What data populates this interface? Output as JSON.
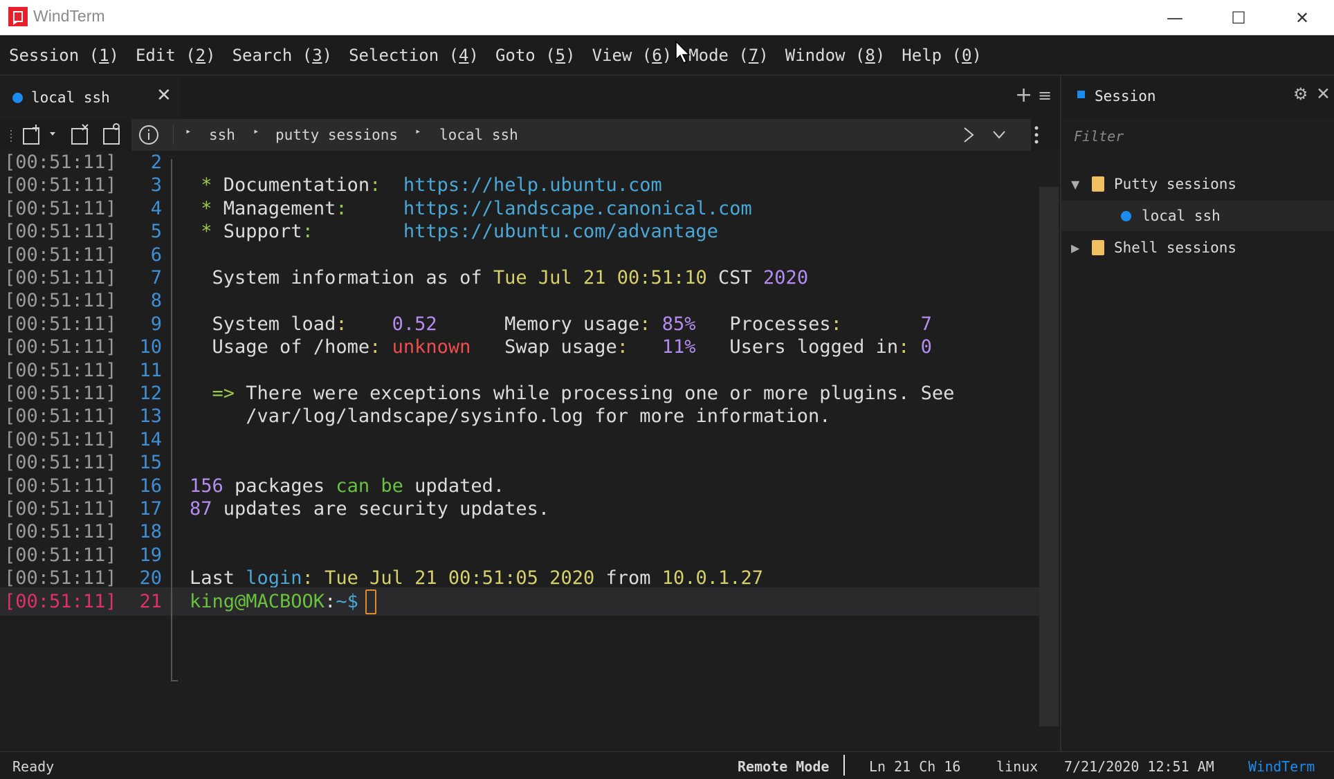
{
  "window": {
    "title": "WindTerm",
    "minimize_glyph": "—",
    "maximize_glyph": "☐",
    "close_glyph": "✕"
  },
  "menu": [
    {
      "label": "Session",
      "key": "1"
    },
    {
      "label": "Edit",
      "key": "2"
    },
    {
      "label": "Search",
      "key": "3"
    },
    {
      "label": "Selection",
      "key": "4"
    },
    {
      "label": "Goto",
      "key": "5"
    },
    {
      "label": "View",
      "key": "6"
    },
    {
      "label": "Mode",
      "key": "7"
    },
    {
      "label": "Window",
      "key": "8"
    },
    {
      "label": "Help",
      "key": "0"
    }
  ],
  "tab": {
    "label": "local ssh",
    "close": "✕",
    "add": "+",
    "menu": "≡"
  },
  "breadcrumb": [
    "ssh",
    "putty sessions",
    "local ssh"
  ],
  "terminal": {
    "lines": [
      {
        "ts": "[00:51:11]",
        "ln": "2",
        "segments": []
      },
      {
        "ts": "[00:51:11]",
        "ln": "3",
        "segments": [
          {
            "t": " * ",
            "c": "g"
          },
          {
            "t": "Documentation",
            "c": "w"
          },
          {
            "t": ":  ",
            "c": "g"
          },
          {
            "t": "https://help.ubuntu.com",
            "c": "b"
          }
        ]
      },
      {
        "ts": "[00:51:11]",
        "ln": "4",
        "segments": [
          {
            "t": " * ",
            "c": "g"
          },
          {
            "t": "Management",
            "c": "w"
          },
          {
            "t": ":     ",
            "c": "g"
          },
          {
            "t": "https://landscape.canonical.com",
            "c": "b"
          }
        ]
      },
      {
        "ts": "[00:51:11]",
        "ln": "5",
        "segments": [
          {
            "t": " * ",
            "c": "g"
          },
          {
            "t": "Support",
            "c": "w"
          },
          {
            "t": ":        ",
            "c": "g"
          },
          {
            "t": "https://ubuntu.com/advantage",
            "c": "b"
          }
        ]
      },
      {
        "ts": "[00:51:11]",
        "ln": "6",
        "segments": []
      },
      {
        "ts": "[00:51:11]",
        "ln": "7",
        "segments": [
          {
            "t": "  System information as of ",
            "c": "w"
          },
          {
            "t": "Tue Jul 21 00:51:10",
            "c": "y"
          },
          {
            "t": " CST ",
            "c": "w"
          },
          {
            "t": "2020",
            "c": "p"
          }
        ]
      },
      {
        "ts": "[00:51:11]",
        "ln": "8",
        "segments": []
      },
      {
        "ts": "[00:51:11]",
        "ln": "9",
        "segments": [
          {
            "t": "  System load",
            "c": "w"
          },
          {
            "t": ":    ",
            "c": "y"
          },
          {
            "t": "0.52",
            "c": "p"
          },
          {
            "t": "      Memory usage",
            "c": "w"
          },
          {
            "t": ": ",
            "c": "y"
          },
          {
            "t": "85%",
            "c": "p"
          },
          {
            "t": "   Processes",
            "c": "w"
          },
          {
            "t": ":       ",
            "c": "y"
          },
          {
            "t": "7",
            "c": "p"
          }
        ]
      },
      {
        "ts": "[00:51:11]",
        "ln": "10",
        "segments": [
          {
            "t": "  Usage of /home",
            "c": "w"
          },
          {
            "t": ": ",
            "c": "y"
          },
          {
            "t": "unknown",
            "c": "r"
          },
          {
            "t": "   Swap usage",
            "c": "w"
          },
          {
            "t": ":   ",
            "c": "y"
          },
          {
            "t": "11%",
            "c": "p"
          },
          {
            "t": "   Users logged in",
            "c": "w"
          },
          {
            "t": ": ",
            "c": "y"
          },
          {
            "t": "0",
            "c": "p"
          }
        ]
      },
      {
        "ts": "[00:51:11]",
        "ln": "11",
        "segments": []
      },
      {
        "ts": "[00:51:11]",
        "ln": "12",
        "segments": [
          {
            "t": "  => ",
            "c": "g"
          },
          {
            "t": "There were exceptions while processing one or more plugins. See",
            "c": "w"
          }
        ]
      },
      {
        "ts": "[00:51:11]",
        "ln": "13",
        "segments": [
          {
            "t": "     /var/log/landscape/sysinfo.log for more information.",
            "c": "w"
          }
        ]
      },
      {
        "ts": "[00:51:11]",
        "ln": "14",
        "segments": []
      },
      {
        "ts": "[00:51:11]",
        "ln": "15",
        "segments": []
      },
      {
        "ts": "[00:51:11]",
        "ln": "16",
        "segments": [
          {
            "t": "156",
            "c": "p"
          },
          {
            "t": " packages ",
            "c": "w"
          },
          {
            "t": "can be",
            "c": "gr"
          },
          {
            "t": " updated.",
            "c": "w"
          }
        ]
      },
      {
        "ts": "[00:51:11]",
        "ln": "17",
        "segments": [
          {
            "t": "87",
            "c": "p"
          },
          {
            "t": " updates are security updates.",
            "c": "w"
          }
        ]
      },
      {
        "ts": "[00:51:11]",
        "ln": "18",
        "segments": []
      },
      {
        "ts": "[00:51:11]",
        "ln": "19",
        "segments": []
      },
      {
        "ts": "[00:51:11]",
        "ln": "20",
        "segments": [
          {
            "t": "Last ",
            "c": "w"
          },
          {
            "t": "login",
            "c": "b"
          },
          {
            "t": ": ",
            "c": "y"
          },
          {
            "t": "Tue Jul 21 00:51:05 2020",
            "c": "y"
          },
          {
            "t": " from ",
            "c": "w"
          },
          {
            "t": "10.0.1.27",
            "c": "y"
          }
        ]
      },
      {
        "ts": "[00:51:11]",
        "ln": "21",
        "current": true,
        "segments": [
          {
            "t": "king@MACBOOK",
            "c": "gr"
          },
          {
            "t": ":",
            "c": "w"
          },
          {
            "t": "~$",
            "c": "b"
          }
        ]
      }
    ]
  },
  "session_panel": {
    "title": "Session",
    "filter_placeholder": "Filter",
    "gear": "⚙",
    "close": "✕",
    "tree": [
      {
        "label": "Putty sessions",
        "expanded": true
      },
      {
        "label": "local ssh",
        "child": true
      },
      {
        "label": "Shell sessions",
        "expanded": false
      }
    ]
  },
  "status": {
    "ready": "Ready",
    "mode": "Remote Mode",
    "position": "Ln 21 Ch 16",
    "os": "linux",
    "datetime": "7/21/2020 12:51 AM",
    "brand": "WindTerm"
  },
  "colors": {
    "accent": "#1a8cf0",
    "line_number": "#3f8fd6",
    "current_line": "#e0306a",
    "green": "#98c94b",
    "yellow": "#d6d06a",
    "purple": "#b58cf0",
    "red": "#ee4d4d"
  }
}
